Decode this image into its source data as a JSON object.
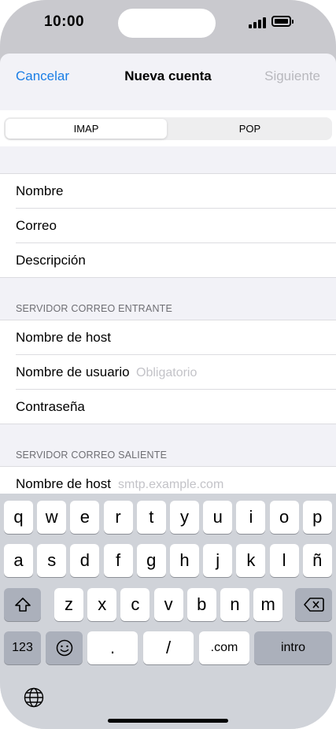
{
  "status_bar": {
    "time": "10:00"
  },
  "nav": {
    "cancel": "Cancelar",
    "title": "Nueva cuenta",
    "next": "Siguiente"
  },
  "segment": {
    "imap": "IMAP",
    "pop": "POP",
    "selected": "IMAP"
  },
  "account_fields": [
    {
      "label": "Nombre"
    },
    {
      "label": "Correo"
    },
    {
      "label": "Descripción"
    }
  ],
  "incoming": {
    "header": "SERVIDOR CORREO ENTRANTE",
    "host_label": "Nombre de host",
    "user_label": "Nombre de usuario",
    "user_placeholder": "Obligatorio",
    "password_label": "Contraseña"
  },
  "outgoing": {
    "header": "SERVIDOR CORREO SALIENTE",
    "host_label": "Nombre de host",
    "host_placeholder": "smtp.example.com"
  },
  "keyboard": {
    "row1": [
      "q",
      "w",
      "e",
      "r",
      "t",
      "y",
      "u",
      "i",
      "o",
      "p"
    ],
    "row2": [
      "a",
      "s",
      "d",
      "f",
      "g",
      "h",
      "j",
      "k",
      "l",
      "ñ"
    ],
    "row3": [
      "z",
      "x",
      "c",
      "v",
      "b",
      "n",
      "m"
    ],
    "numbers_key": "123",
    "dot_key": ".",
    "slash_key": "/",
    "dotcom_key": ".com",
    "return_key": "intro"
  },
  "colors": {
    "accent": "#1a7ee6",
    "disabled": "#b8b8bd",
    "placeholder": "#c3c3c8"
  }
}
